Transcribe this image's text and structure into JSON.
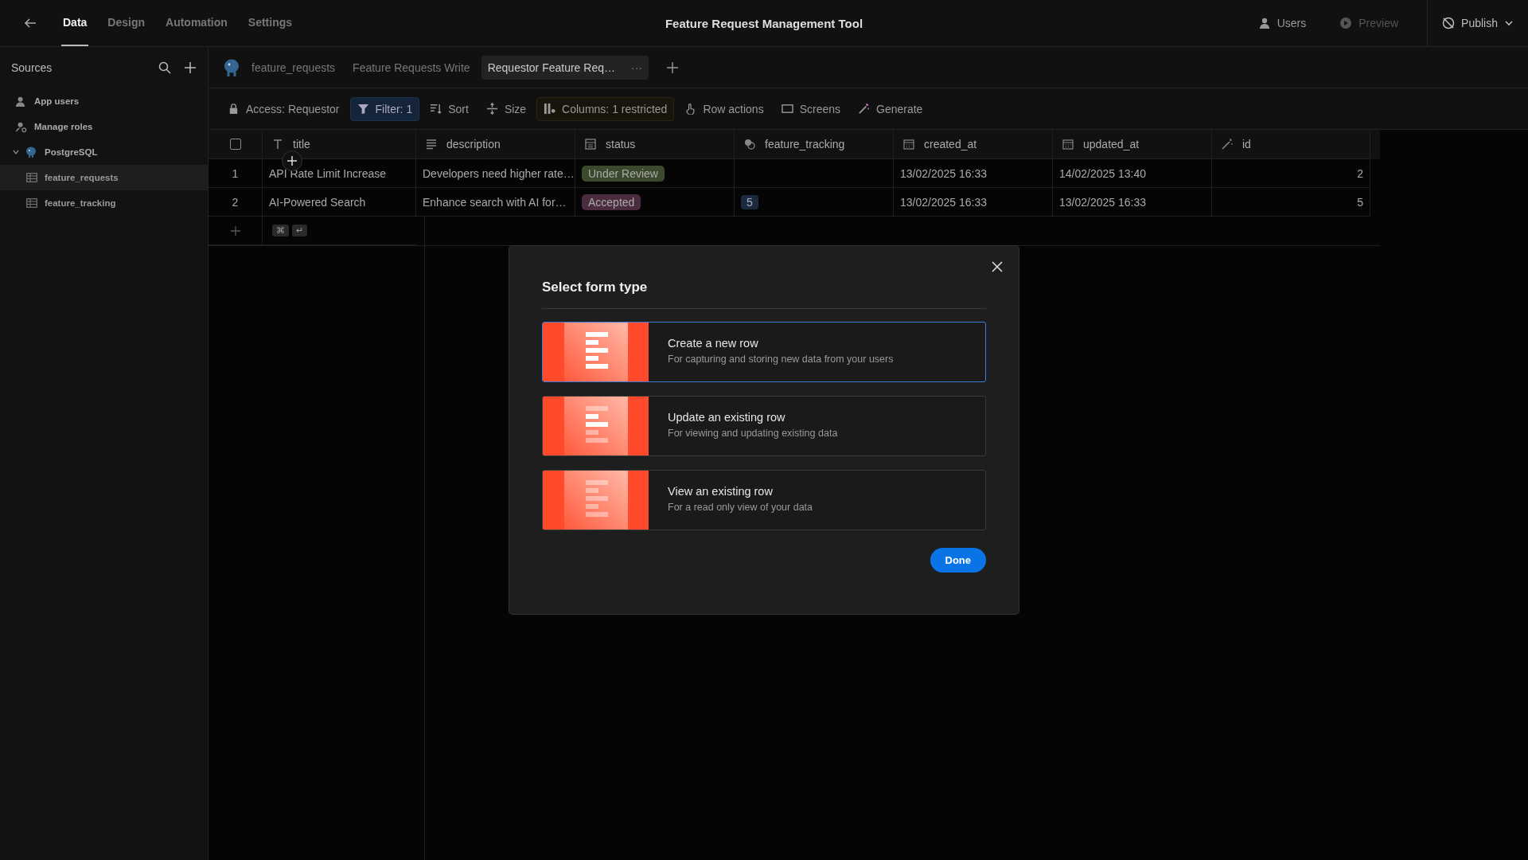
{
  "topbar": {
    "nav": [
      {
        "label": "Data",
        "selected": true
      },
      {
        "label": "Design",
        "selected": false
      },
      {
        "label": "Automation",
        "selected": false
      },
      {
        "label": "Settings",
        "selected": false
      }
    ],
    "title": "Feature Request Management Tool",
    "actions": [
      {
        "kind": "users",
        "label": "Users",
        "disabled": false
      },
      {
        "kind": "preview",
        "label": "Preview",
        "disabled": true
      }
    ],
    "publish": "Publish"
  },
  "sidebar": {
    "heading": "Sources",
    "items": [
      {
        "kind": "users",
        "label": "App users"
      },
      {
        "kind": "roles",
        "label": "Manage roles"
      },
      {
        "kind": "database",
        "label": "PostgreSQL",
        "expanded": true,
        "children": [
          {
            "label": "feature_requests",
            "selected": true
          },
          {
            "label": "feature_tracking",
            "selected": false
          }
        ]
      }
    ]
  },
  "tabs": [
    {
      "label": "feature_requests",
      "selected": false
    },
    {
      "label": "Feature Requests Write",
      "selected": false
    },
    {
      "label": "Requestor Feature Req…",
      "selected": true,
      "more": "···"
    }
  ],
  "toolbar": [
    {
      "kind": "access",
      "label": "Access: Requestor",
      "highlighted": false
    },
    {
      "kind": "filter",
      "label": "Filter: 1",
      "highlighted": true
    },
    {
      "kind": "sort",
      "label": "Sort",
      "highlighted": false
    },
    {
      "kind": "size",
      "label": "Size",
      "highlighted": false
    },
    {
      "kind": "columns",
      "label": "Columns: 1 restricted",
      "highlighted": true
    },
    {
      "kind": "row_actions",
      "label": "Row actions",
      "highlighted": false
    },
    {
      "kind": "screens",
      "label": "Screens",
      "highlighted": false
    },
    {
      "kind": "generate",
      "label": "Generate",
      "highlighted": false
    }
  ],
  "table": {
    "columns": [
      {
        "kind": "text",
        "label": "title"
      },
      {
        "kind": "longform",
        "label": "description"
      },
      {
        "kind": "options",
        "label": "status"
      },
      {
        "kind": "link",
        "label": "feature_tracking"
      },
      {
        "kind": "datetime",
        "label": "created_at"
      },
      {
        "kind": "datetime",
        "label": "updated_at"
      },
      {
        "kind": "auto",
        "label": "id"
      }
    ],
    "rows": [
      {
        "index": "1",
        "title": "API Rate Limit Increase",
        "description": "Developers need higher rate…",
        "status": {
          "label": "Under Review",
          "color": "#3b4a2c"
        },
        "feature_tracking": null,
        "created_at": "13/02/2025 16:33",
        "updated_at": "14/02/2025 13:40",
        "id": "2"
      },
      {
        "index": "2",
        "title": "AI-Powered Search",
        "description": "Enhance search with AI for…",
        "status": {
          "label": "Accepted",
          "color": "#4a2c3e"
        },
        "feature_tracking": "5",
        "created_at": "13/02/2025 16:33",
        "updated_at": "13/02/2025 16:33",
        "id": "5"
      }
    ],
    "shortcut_keys": [
      "⌘",
      "↵"
    ],
    "all_checked": false
  },
  "modal": {
    "title": "Select form type",
    "options": [
      {
        "kind": "create",
        "title": "Create a new row",
        "subtitle": "For capturing and storing new data from your users",
        "selected": true
      },
      {
        "kind": "update",
        "title": "Update an existing row",
        "subtitle": "For viewing and updating existing data",
        "selected": false
      },
      {
        "kind": "view",
        "title": "View an existing row",
        "subtitle": "For a read only view of your data",
        "selected": false
      }
    ],
    "done": "Done"
  }
}
